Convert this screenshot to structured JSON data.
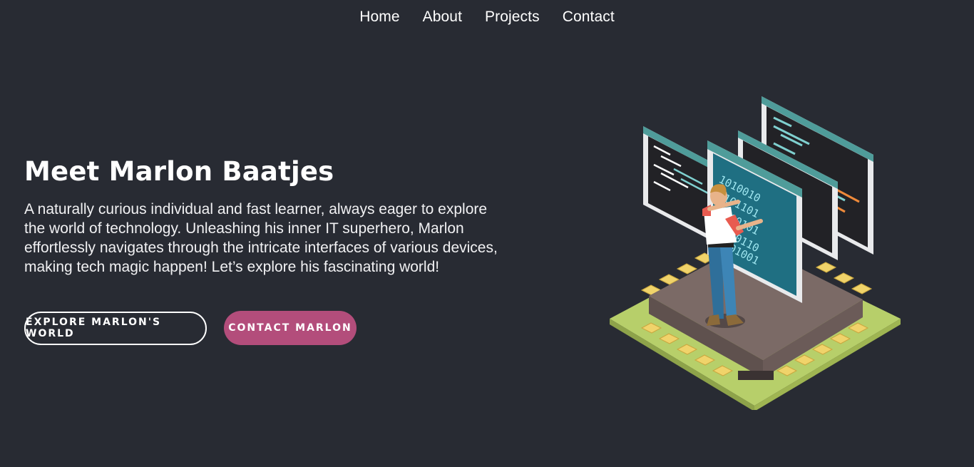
{
  "nav": {
    "items": [
      {
        "label": "Home"
      },
      {
        "label": "About"
      },
      {
        "label": "Projects"
      },
      {
        "label": "Contact"
      }
    ]
  },
  "hero": {
    "title": "Meet Marlon Baatjes",
    "description": "A naturally curious individual and fast learner, always eager to explore the world of technology. Unleashing his inner IT superhero, Marlon effortlessly navigates through the intricate interfaces of various devices, making tech magic happen! Let’s explore his fascinating world!",
    "buttons": {
      "explore_label": "Explore Marlon's World",
      "contact_label": "Contact Marlon"
    }
  },
  "illustration": {
    "icon": "developer-with-holographic-code-screens-illustration"
  },
  "colors": {
    "background": "#282b33",
    "accent": "#b34d7b",
    "text": "#ffffff"
  }
}
